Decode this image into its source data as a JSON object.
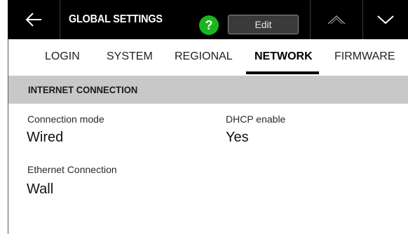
{
  "header": {
    "title": "GLOBAL SETTINGS",
    "help_label": "?",
    "edit_label": "Edit",
    "icons": {
      "back": "back-arrow-icon",
      "up": "chevron-up-icon",
      "down": "chevron-down-icon"
    },
    "colors": {
      "background": "#000000",
      "help": "#1bb520"
    }
  },
  "tabs": [
    {
      "label": "LOGIN",
      "active": false
    },
    {
      "label": "SYSTEM",
      "active": false
    },
    {
      "label": "REGIONAL",
      "active": false
    },
    {
      "label": "NETWORK",
      "active": true
    },
    {
      "label": "FIRMWARE",
      "active": false
    }
  ],
  "section": {
    "title": "INTERNET CONNECTION",
    "fields": [
      {
        "label": "Connection mode",
        "value": "Wired"
      },
      {
        "label": "DHCP enable",
        "value": "Yes"
      },
      {
        "label": "Ethernet Connection",
        "value": "Wall"
      }
    ]
  }
}
